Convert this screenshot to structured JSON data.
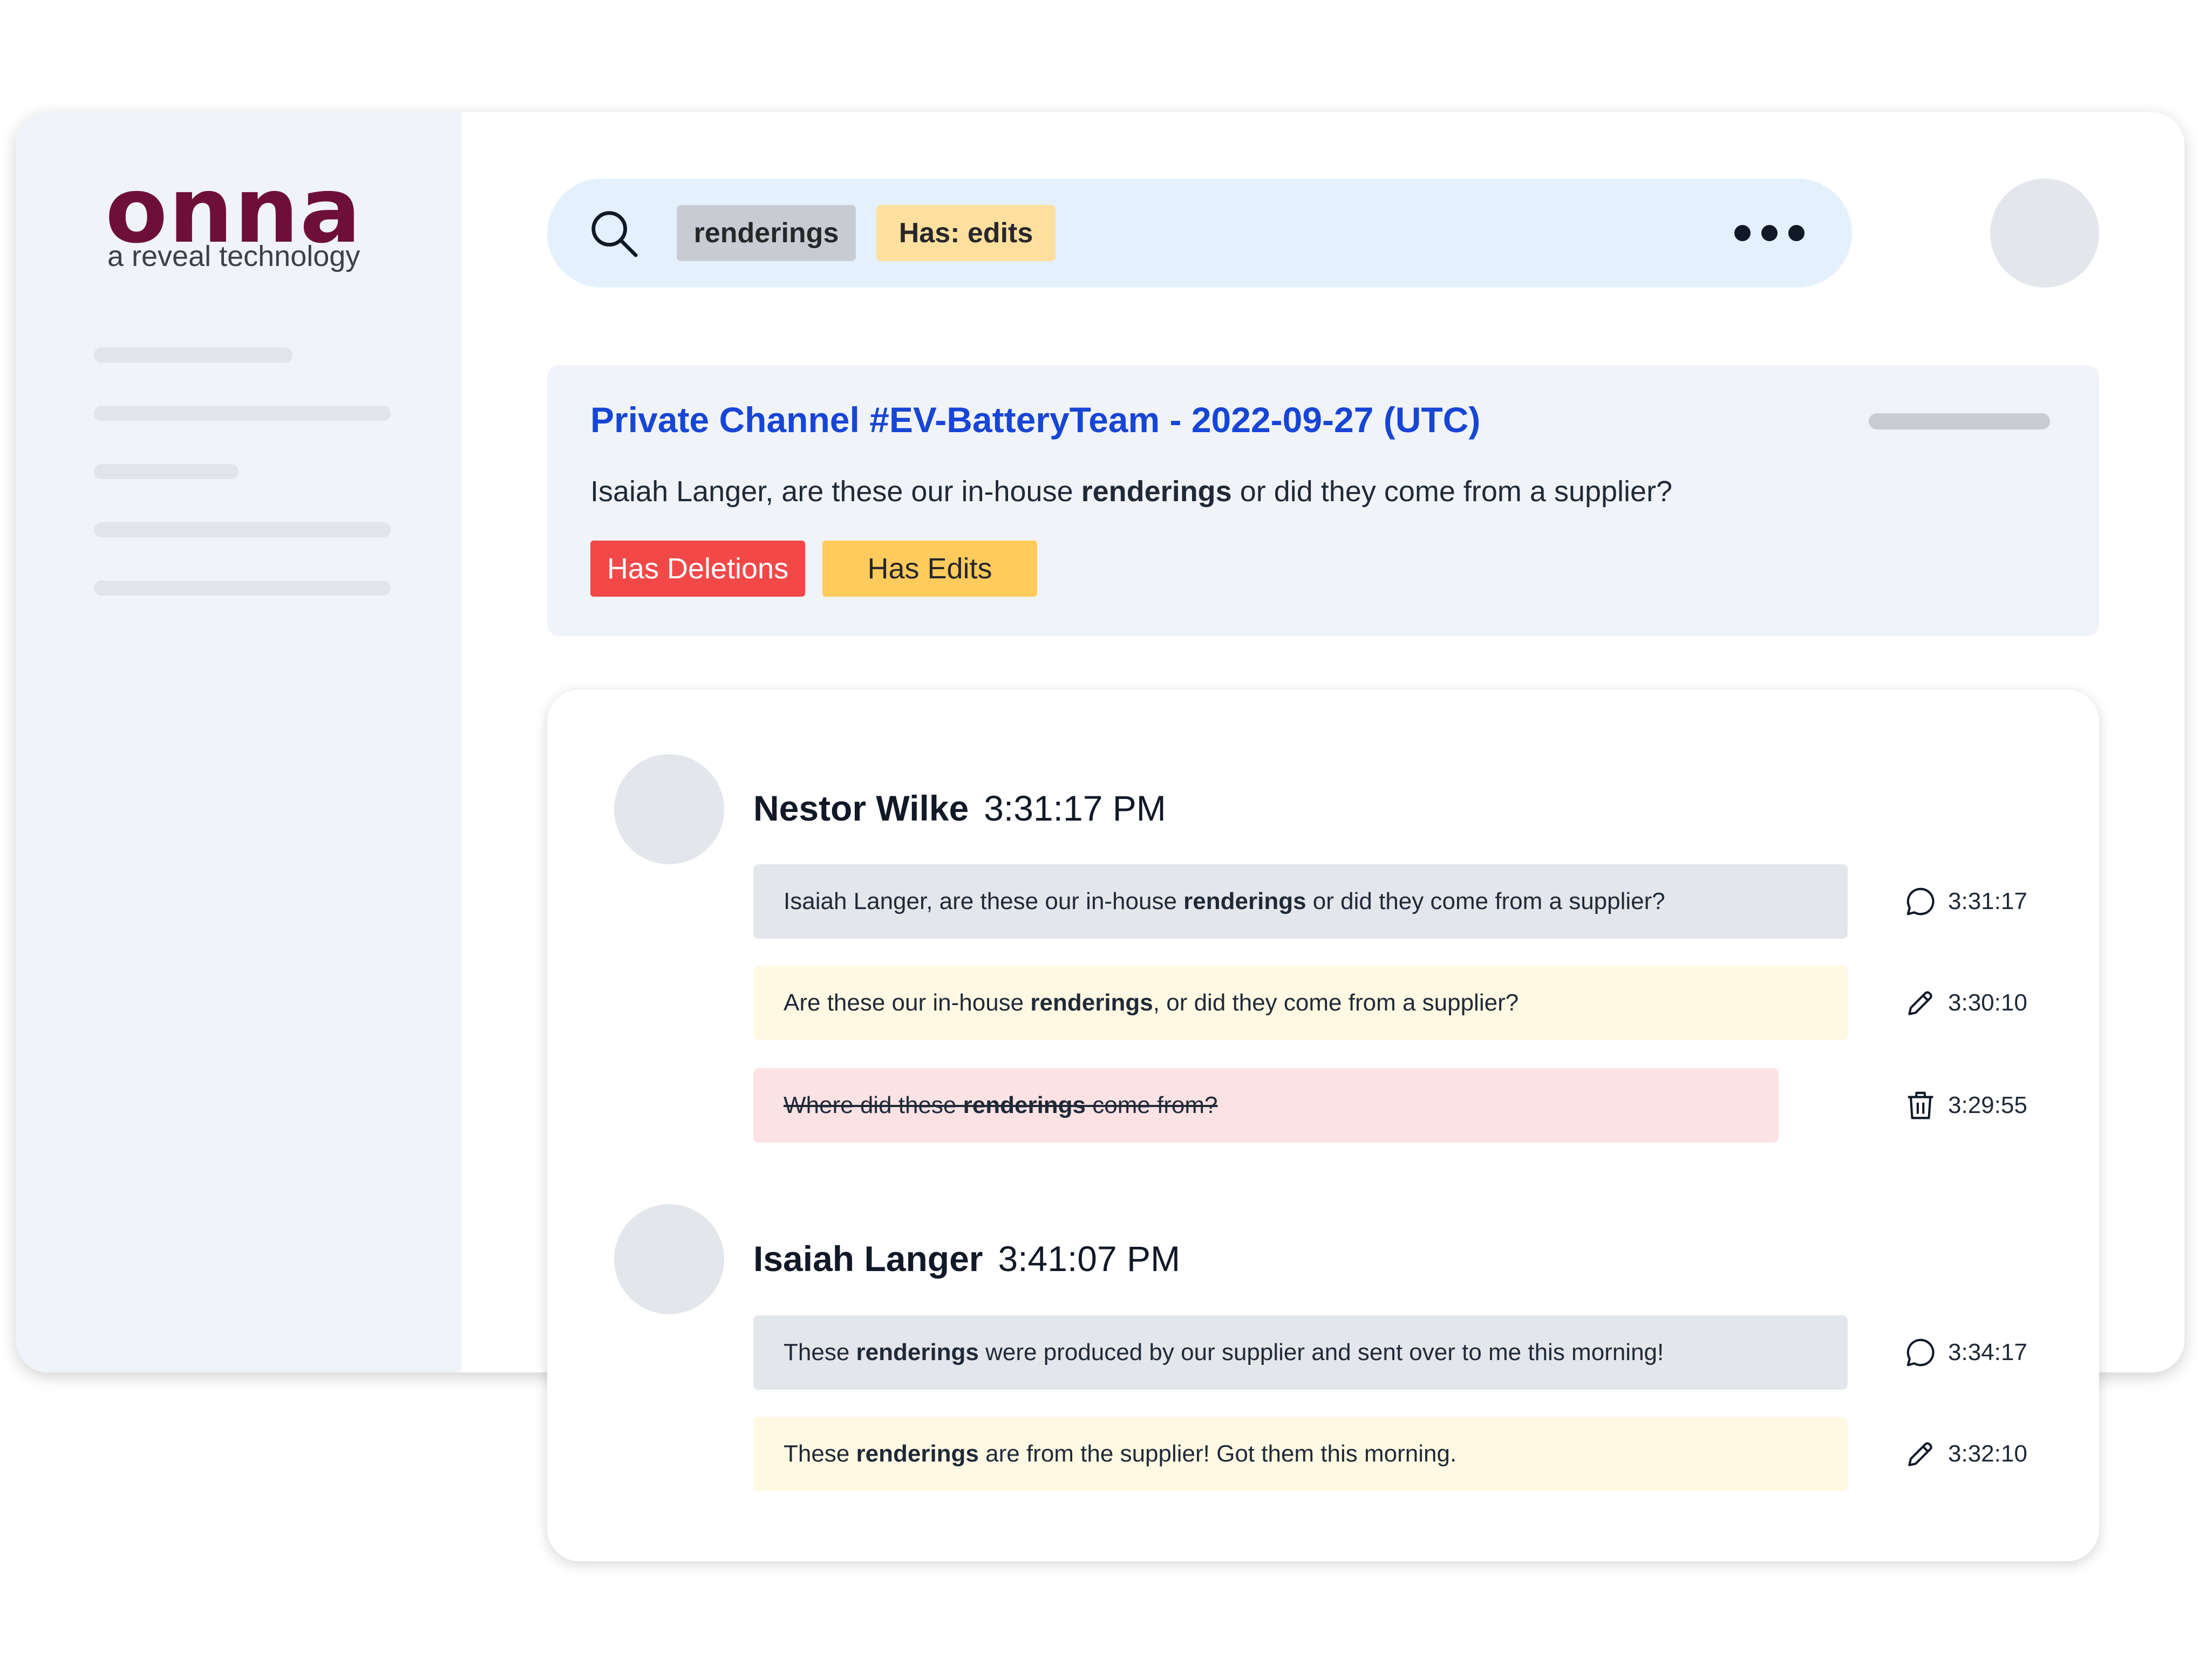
{
  "brand": {
    "name": "onna",
    "tagline": "a reveal technology",
    "color": "#6e0f3a"
  },
  "search": {
    "chips": [
      {
        "label": "renderings",
        "color": "#c8ccd2"
      },
      {
        "label": "Has: edits",
        "color": "#ffdf9e"
      }
    ],
    "icons": [
      "search-icon",
      "more-icon"
    ]
  },
  "result": {
    "title": "Private Channel #EV-BatteryTeam - 2022-09-27 (UTC)",
    "snippet": {
      "before": "Isaiah Langer, are these our in-house ",
      "highlight": "renderings",
      "after": " or did they come from a supplier?"
    },
    "tags": [
      {
        "label": "Has Deletions",
        "color": "#f34848"
      },
      {
        "label": "Has Edits",
        "color": "#ffcb5d"
      }
    ]
  },
  "thread": {
    "groups": [
      {
        "author": "Nestor Wilke",
        "time": "3:31:17 PM",
        "messages": [
          {
            "type": "original",
            "icon": "comment-icon",
            "before": "Isaiah Langer, are these our in-house ",
            "highlight": "renderings",
            "after": " or did they come from a supplier?",
            "time": "3:31:17"
          },
          {
            "type": "edit",
            "icon": "pencil-icon",
            "before": "Are these our in-house ",
            "highlight": "renderings",
            "after": ", or did they come from a supplier?",
            "time": "3:30:10"
          },
          {
            "type": "deleted",
            "icon": "trash-icon",
            "before": "Where did these ",
            "highlight": "renderings",
            "after": " come from?",
            "time": "3:29:55"
          }
        ]
      },
      {
        "author": "Isaiah Langer",
        "time": "3:41:07 PM",
        "messages": [
          {
            "type": "original",
            "icon": "comment-icon",
            "before": "These ",
            "highlight": "renderings",
            "after": " were produced by our supplier and sent over to me this morning!",
            "time": "3:34:17"
          },
          {
            "type": "edit",
            "icon": "pencil-icon",
            "before": "These ",
            "highlight": "renderings",
            "after": " are from the supplier! Got them this morning.",
            "time": "3:32:10"
          }
        ]
      }
    ]
  }
}
